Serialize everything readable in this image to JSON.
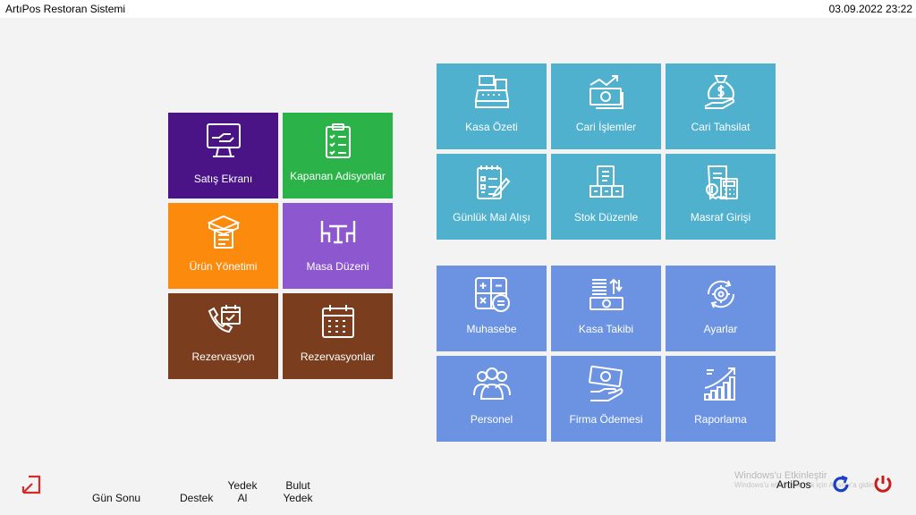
{
  "window": {
    "title": "ArtıPos Restoran Sistemi",
    "datetime": "03.09.2022 23:22"
  },
  "left_tiles": [
    {
      "label": "Satış Ekranı",
      "icon": "monitor-hand-icon",
      "color": "#4a1486"
    },
    {
      "label": "Kapanan Adisyonlar",
      "icon": "clipboard-checklist-icon",
      "color": "#2bb34a"
    },
    {
      "label": "Ürün Yönetimi",
      "icon": "box-list-icon",
      "color": "#fb8a0d"
    },
    {
      "label": "Masa Düzeni",
      "icon": "table-chairs-icon",
      "color": "#8d57cf"
    },
    {
      "label": "Rezervasyon",
      "icon": "phone-calendar-icon",
      "color": "#7a3d1d"
    },
    {
      "label": "Rezervasyonlar",
      "icon": "calendar-grid-icon",
      "color": "#7a3d1d"
    }
  ],
  "top_right_tiles": [
    {
      "label": "Kasa Özeti",
      "icon": "cash-register-icon",
      "color": "#4fb1ce"
    },
    {
      "label": "Cari İşlemler",
      "icon": "money-growth-icon",
      "color": "#4fb1ce"
    },
    {
      "label": "Cari Tahsilat",
      "icon": "money-bag-icon",
      "color": "#4fb1ce"
    },
    {
      "label": "Günlük Mal Alışı",
      "icon": "checklist-pen-icon",
      "color": "#4fb1ce"
    },
    {
      "label": "Stok Düzenle",
      "icon": "stock-boxes-icon",
      "color": "#4fb1ce"
    },
    {
      "label": "Masraf Girişi",
      "icon": "receipt-calculator-icon",
      "color": "#4fb1ce"
    }
  ],
  "bottom_right_tiles": [
    {
      "label": "Muhasebe",
      "icon": "calculator-icon",
      "color": "#6b93e2"
    },
    {
      "label": "Kasa Takibi",
      "icon": "cash-stack-icon",
      "color": "#6b93e2"
    },
    {
      "label": "Ayarlar",
      "icon": "gear-cycle-icon",
      "color": "#6b93e2"
    },
    {
      "label": "Personel",
      "icon": "people-group-icon",
      "color": "#6b93e2"
    },
    {
      "label": "Firma Ödemesi",
      "icon": "hand-cash-icon",
      "color": "#6b93e2"
    },
    {
      "label": "Raporlama",
      "icon": "bar-chart-up-icon",
      "color": "#6b93e2"
    }
  ],
  "bottom_bar": {
    "gun_sonu": "Gün Sonu",
    "destek": "Destek",
    "yedek_al_1": "Yedek",
    "yedek_al_2": "Al",
    "bulut_yedek_1": "Bulut",
    "bulut_yedek_2": "Yedek",
    "brand": "ArtiPos",
    "watermark_title": "Windows'u Etkinleştir",
    "watermark_sub": "Windows'u etkinleştirmek için Ayarlar'a gidin.",
    "exit_icon": "exit-arrow-icon",
    "refresh_icon": "refresh-icon",
    "power_icon": "power-icon"
  }
}
